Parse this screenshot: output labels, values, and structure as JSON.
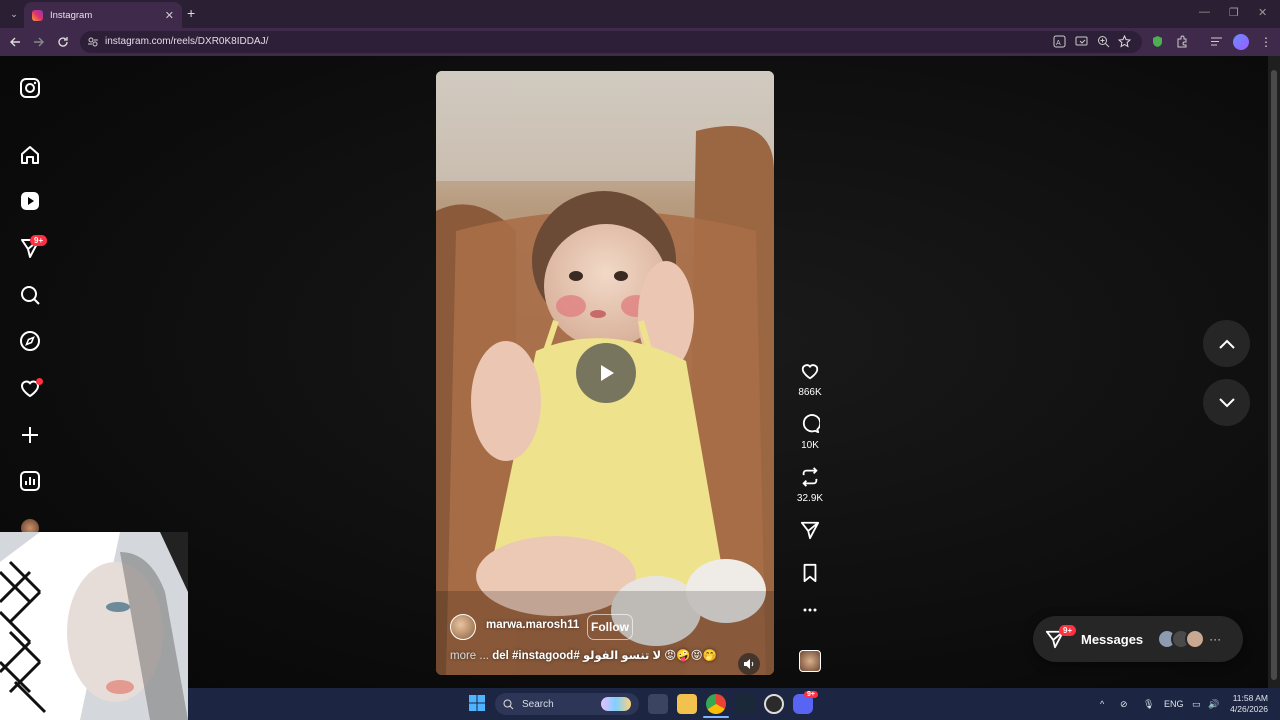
{
  "browser": {
    "tab_title": "Instagram",
    "url": "instagram.com/reels/DXR0K8IDDAJ/"
  },
  "sidebar": {
    "notifications_badge": "9+"
  },
  "reel": {
    "username": "marwa.marosh11",
    "follow_label": "Follow",
    "caption_more": "more ... ",
    "caption_text": "del #instagood# لا تنسو الفولو",
    "caption_emojis": "😡🤪😝🤭",
    "likes": "866K",
    "comments": "10K",
    "reposts": "32.9K"
  },
  "messages": {
    "label": "Messages",
    "badge": "9+"
  },
  "taskbar": {
    "search_placeholder": "Search",
    "language": "ENG",
    "time": "11:58 AM",
    "date": "4/26/2026",
    "discord_badge": "9+"
  },
  "colors": {
    "accent_red": "#ff3040",
    "browser_frame": "#3f2a4b",
    "taskbar": "#1c2541"
  }
}
